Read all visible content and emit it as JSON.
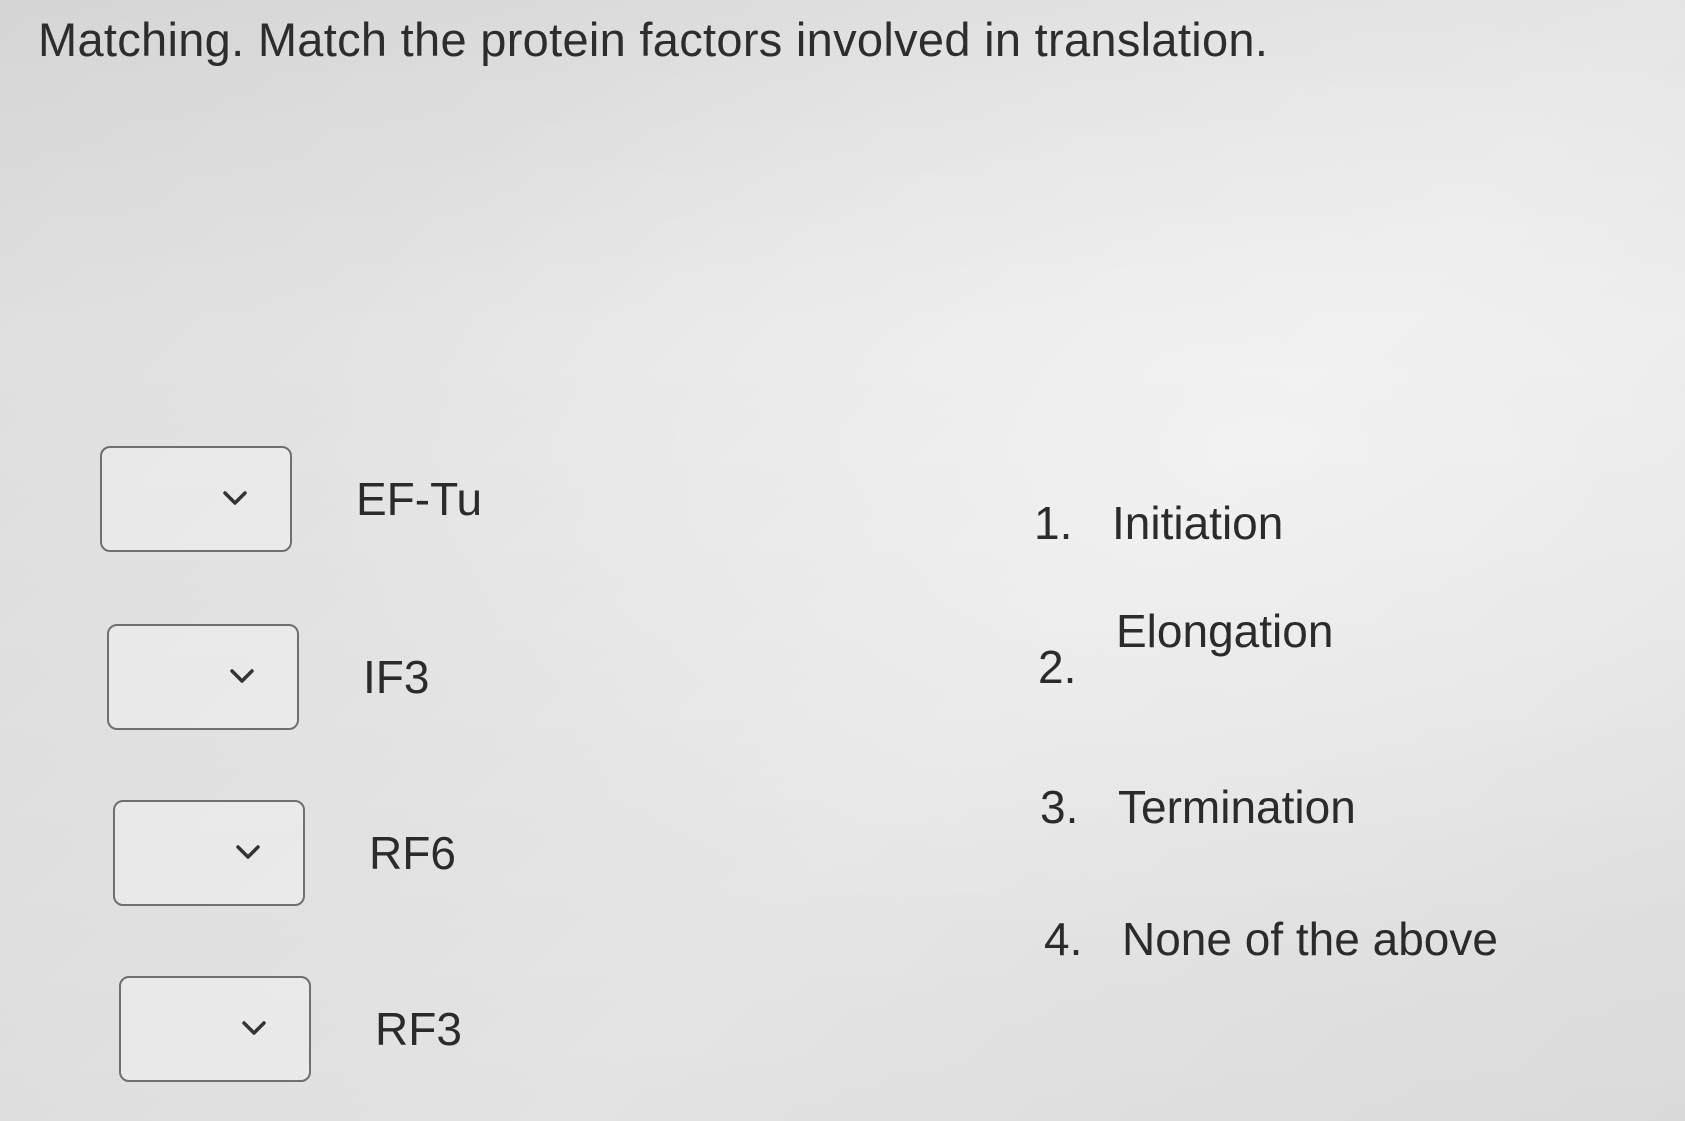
{
  "question": {
    "title": "Matching. Match the protein factors involved in translation."
  },
  "factors": [
    {
      "label": "EF-Tu",
      "selected": ""
    },
    {
      "label": "IF3",
      "selected": ""
    },
    {
      "label": "RF6",
      "selected": ""
    },
    {
      "label": "RF3",
      "selected": ""
    }
  ],
  "options": [
    {
      "number": "1.",
      "label": "Initiation"
    },
    {
      "number": "2.",
      "label": "Elongation"
    },
    {
      "number": "3.",
      "label": "Termination"
    },
    {
      "number": "4.",
      "label": "None of the above"
    }
  ],
  "icons": {
    "dropdown": "chevron-down-icon"
  }
}
